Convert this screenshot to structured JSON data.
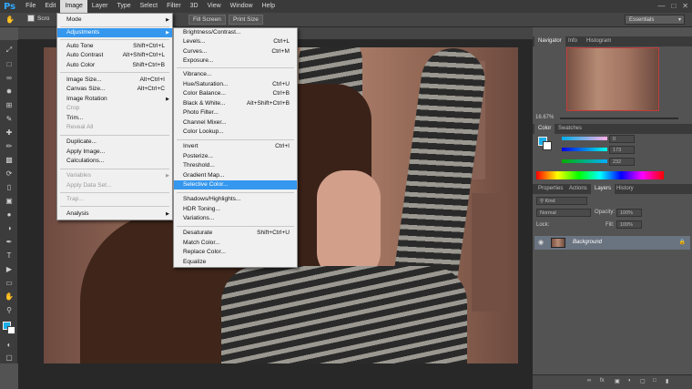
{
  "app": {
    "logo": "Ps"
  },
  "menubar": [
    "File",
    "Edit",
    "Image",
    "Layer",
    "Type",
    "Select",
    "Filter",
    "3D",
    "View",
    "Window",
    "Help"
  ],
  "options": {
    "scroll_label": "Scro",
    "fill_screen": "Fill Screen",
    "print_size": "Print Size",
    "workspace": "Essentials"
  },
  "image_menu": {
    "mode": "Mode",
    "adjustments": "Adjustments",
    "auto_tone": {
      "label": "Auto Tone",
      "shortcut": "Shift+Ctrl+L"
    },
    "auto_contrast": {
      "label": "Auto Contrast",
      "shortcut": "Alt+Shift+Ctrl+L"
    },
    "auto_color": {
      "label": "Auto Color",
      "shortcut": "Shift+Ctrl+B"
    },
    "image_size": {
      "label": "Image Size...",
      "shortcut": "Alt+Ctrl+I"
    },
    "canvas_size": {
      "label": "Canvas Size...",
      "shortcut": "Alt+Ctrl+C"
    },
    "image_rotation": "Image Rotation",
    "crop": "Crop",
    "trim": "Trim...",
    "reveal_all": "Reveal All",
    "duplicate": "Duplicate...",
    "apply_image": "Apply Image...",
    "calculations": "Calculations...",
    "variables": "Variables",
    "apply_data_set": "Apply Data Set...",
    "trap": "Trap...",
    "analysis": "Analysis"
  },
  "adjust_menu": {
    "brightness": {
      "label": "Brightness/Contrast...",
      "shortcut": ""
    },
    "levels": {
      "label": "Levels...",
      "shortcut": "Ctrl+L"
    },
    "curves": {
      "label": "Curves...",
      "shortcut": "Ctrl+M"
    },
    "exposure": {
      "label": "Exposure...",
      "shortcut": ""
    },
    "vibrance": {
      "label": "Vibrance...",
      "shortcut": ""
    },
    "hue_sat": {
      "label": "Hue/Saturation...",
      "shortcut": "Ctrl+U"
    },
    "color_balance": {
      "label": "Color Balance...",
      "shortcut": "Ctrl+B"
    },
    "bw": {
      "label": "Black & White...",
      "shortcut": "Alt+Shift+Ctrl+B"
    },
    "photo_filter": {
      "label": "Photo Filter...",
      "shortcut": ""
    },
    "channel_mixer": {
      "label": "Channel Mixer...",
      "shortcut": ""
    },
    "color_lookup": {
      "label": "Color Lookup...",
      "shortcut": ""
    },
    "invert": {
      "label": "Invert",
      "shortcut": "Ctrl+I"
    },
    "posterize": {
      "label": "Posterize...",
      "shortcut": ""
    },
    "threshold": {
      "label": "Threshold...",
      "shortcut": ""
    },
    "gradient_map": {
      "label": "Gradient Map...",
      "shortcut": ""
    },
    "selective_color": {
      "label": "Selective Color...",
      "shortcut": ""
    },
    "shadows": {
      "label": "Shadows/Highlights...",
      "shortcut": ""
    },
    "hdr": {
      "label": "HDR Toning...",
      "shortcut": ""
    },
    "variations": {
      "label": "Variations...",
      "shortcut": ""
    },
    "desaturate": {
      "label": "Desaturate",
      "shortcut": "Shift+Ctrl+U"
    },
    "match_color": {
      "label": "Match Color...",
      "shortcut": ""
    },
    "replace_color": {
      "label": "Replace Color...",
      "shortcut": ""
    },
    "equalize": {
      "label": "Equalize",
      "shortcut": ""
    }
  },
  "panels": {
    "nav_tabs": [
      "Navigator",
      "Info",
      "Histogram"
    ],
    "zoom": "16.67%",
    "color_tabs": [
      "Color",
      "Swatches"
    ],
    "rgb": {
      "r": "0",
      "g": "173",
      "b": "232"
    },
    "layer_tabs": [
      "Properties",
      "Actions",
      "Layers",
      "History"
    ],
    "kind": "Kind",
    "blend": "Normal",
    "opacity_label": "Opacity:",
    "opacity": "100%",
    "lock_label": "Lock:",
    "fill_label": "Fill:",
    "fill": "100%",
    "layer_name": "Background"
  },
  "colors": {
    "accent": "#3597ee",
    "fg": "#1baee8"
  }
}
